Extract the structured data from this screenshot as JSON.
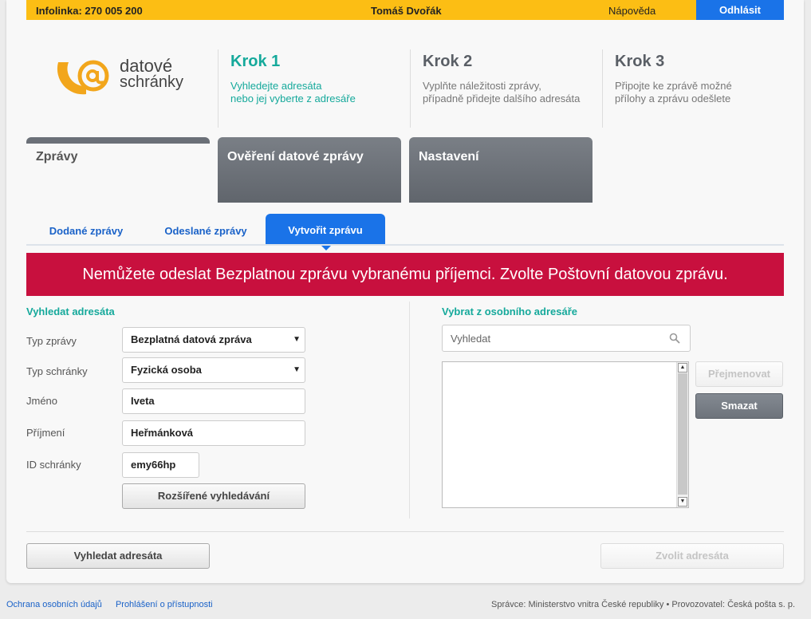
{
  "topbar": {
    "infoline": "Infolinka: 270 005 200",
    "user": "Tomáš Dvořák",
    "help": "Nápověda",
    "logout": "Odhlásit"
  },
  "logo": {
    "line1": "datové",
    "line2": "schránky"
  },
  "steps": [
    {
      "title": "Krok 1",
      "desc1": "Vyhledejte adresáta",
      "desc2": "nebo jej vyberte z adresáře"
    },
    {
      "title": "Krok 2",
      "desc1": "Vyplňte náležitosti zprávy,",
      "desc2": "případně přidejte dalšího adresáta"
    },
    {
      "title": "Krok 3",
      "desc1": "Připojte ke zprávě možné",
      "desc2": "přílohy a zprávu odešlete"
    }
  ],
  "maintabs": [
    "Zprávy",
    "Ověření datové zprávy",
    "Nastavení"
  ],
  "subtabs": [
    "Dodané zprávy",
    "Odeslané zprávy",
    "Vytvořit zprávu"
  ],
  "alert": "Nemůžete odeslat Bezplatnou zprávu vybranému příjemci. Zvolte Poštovní datovou zprávu.",
  "left": {
    "title": "Vyhledat adresáta",
    "labels": {
      "type": "Typ zprávy",
      "box_type": "Typ schránky",
      "name": "Jméno",
      "surname": "Příjmení",
      "box_id": "ID schránky"
    },
    "values": {
      "type": "Bezplatná datová zpráva",
      "box_type": "Fyzická osoba",
      "name": "Iveta",
      "surname": "Heřmánková",
      "box_id": "emy66hp"
    },
    "advanced_button": "Rozšířené vyhledávání"
  },
  "right": {
    "title": "Vybrat z osobního adresáře",
    "search_placeholder": "Vyhledat",
    "rename_button": "Přejmenovat",
    "delete_button": "Smazat"
  },
  "bottom": {
    "search_button": "Vyhledat adresáta",
    "choose_button": "Zvolit adresáta"
  },
  "footer": {
    "privacy": "Ochrana osobních údajů",
    "accessibility": "Prohlášení o přístupnosti",
    "operator": "Správce: Ministerstvo vnitra České republiky • Provozovatel: Česká pošta s. p."
  },
  "colors": {
    "accent": "#15a99b",
    "blue": "#1a73e8",
    "alert": "#c8103e",
    "yellow": "#fcbe14"
  }
}
